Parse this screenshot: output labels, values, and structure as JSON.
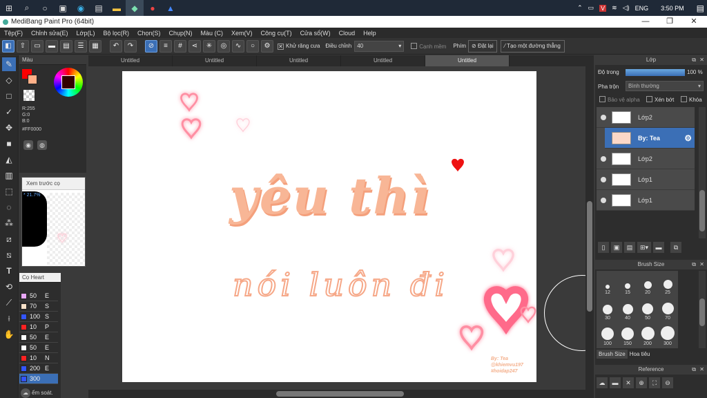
{
  "taskbar": {
    "time": "3:50 PM",
    "lang": "ENG"
  },
  "window": {
    "title": "MediBang Paint Pro (64bit)",
    "minimize": "—",
    "maximize": "❐",
    "close": "✕"
  },
  "menu": [
    "Tệp(F)",
    "Chỉnh sửa(E)",
    "Lớp(L)",
    "Bộ lọc(R)",
    "Chọn(S)",
    "Chụp(N)",
    "Màu (C)",
    "Xem(V)",
    "Công cụ(T)",
    "Cửa sổ(W)",
    "Cloud",
    "Help"
  ],
  "toolbar": {
    "antialias_label": "Khử răng cưa",
    "adjust_label": "Điều chỉnh",
    "adjust_value": "40",
    "edge_label": "Cạnh mềm",
    "key_label": "Phím",
    "reset_label": "Đặt lại",
    "straight_line_label": "Tạo một đường thẳng"
  },
  "color_panel": {
    "title": "Màu",
    "r": "R:255",
    "g": "G:0",
    "b": "B:0",
    "hex": "#FF0000"
  },
  "preview_panel": {
    "title": "Xem trước cọ",
    "zoom": "* 21.7%"
  },
  "brush_list": {
    "title": "Cọ Heart",
    "items": [
      {
        "color": "#e7a6f7",
        "size": "50",
        "letter": "E"
      },
      {
        "color": "#f7e0c8",
        "size": "70",
        "letter": "S"
      },
      {
        "color": "#3355ff",
        "size": "100",
        "letter": "S"
      },
      {
        "color": "#ff2222",
        "size": "10",
        "letter": "P"
      },
      {
        "color": "#ffffff",
        "size": "50",
        "letter": "E"
      },
      {
        "color": "#ffffff",
        "size": "50",
        "letter": "E"
      },
      {
        "color": "#ff2222",
        "size": "10",
        "letter": "N"
      },
      {
        "color": "#3355ff",
        "size": "200",
        "letter": "E"
      },
      {
        "color": "#3355ff",
        "size": "300",
        "letter": ""
      }
    ],
    "footer": "ểm soát."
  },
  "tabs": [
    "Untitled",
    "Untitled",
    "Untitled",
    "Untitled",
    "Untitled"
  ],
  "canvas": {
    "line1": "yêu thì",
    "line2": "nói luôn đi",
    "credit1": "By: Tea",
    "credit2": "@khiemvu197",
    "credit3": "#hoidap247"
  },
  "layer_panel": {
    "title": "Lớp",
    "opacity_label": "Độ trong",
    "opacity_value": "100 %",
    "blend_label": "Pha trộn",
    "blend_value": "Bình thường",
    "protect_alpha": "Bảo vệ alpha",
    "clip": "Xén bớt",
    "lock": "Khóa",
    "layers": [
      {
        "name": "Lớp2",
        "selected": false
      },
      {
        "name": "By: Tea",
        "selected": true
      },
      {
        "name": "Lớp2",
        "selected": false
      },
      {
        "name": "Lớp1",
        "selected": false
      },
      {
        "name": "Lớp1",
        "selected": false
      }
    ]
  },
  "brush_size_panel": {
    "title": "Brush Size",
    "sizes": [
      "12",
      "15",
      "20",
      "25",
      "30",
      "40",
      "50",
      "70",
      "100",
      "150",
      "200",
      "300"
    ],
    "tab_active": "Brush Size",
    "tab_other": "Hoa tiêu"
  },
  "reference_panel": {
    "title": "Reference"
  }
}
